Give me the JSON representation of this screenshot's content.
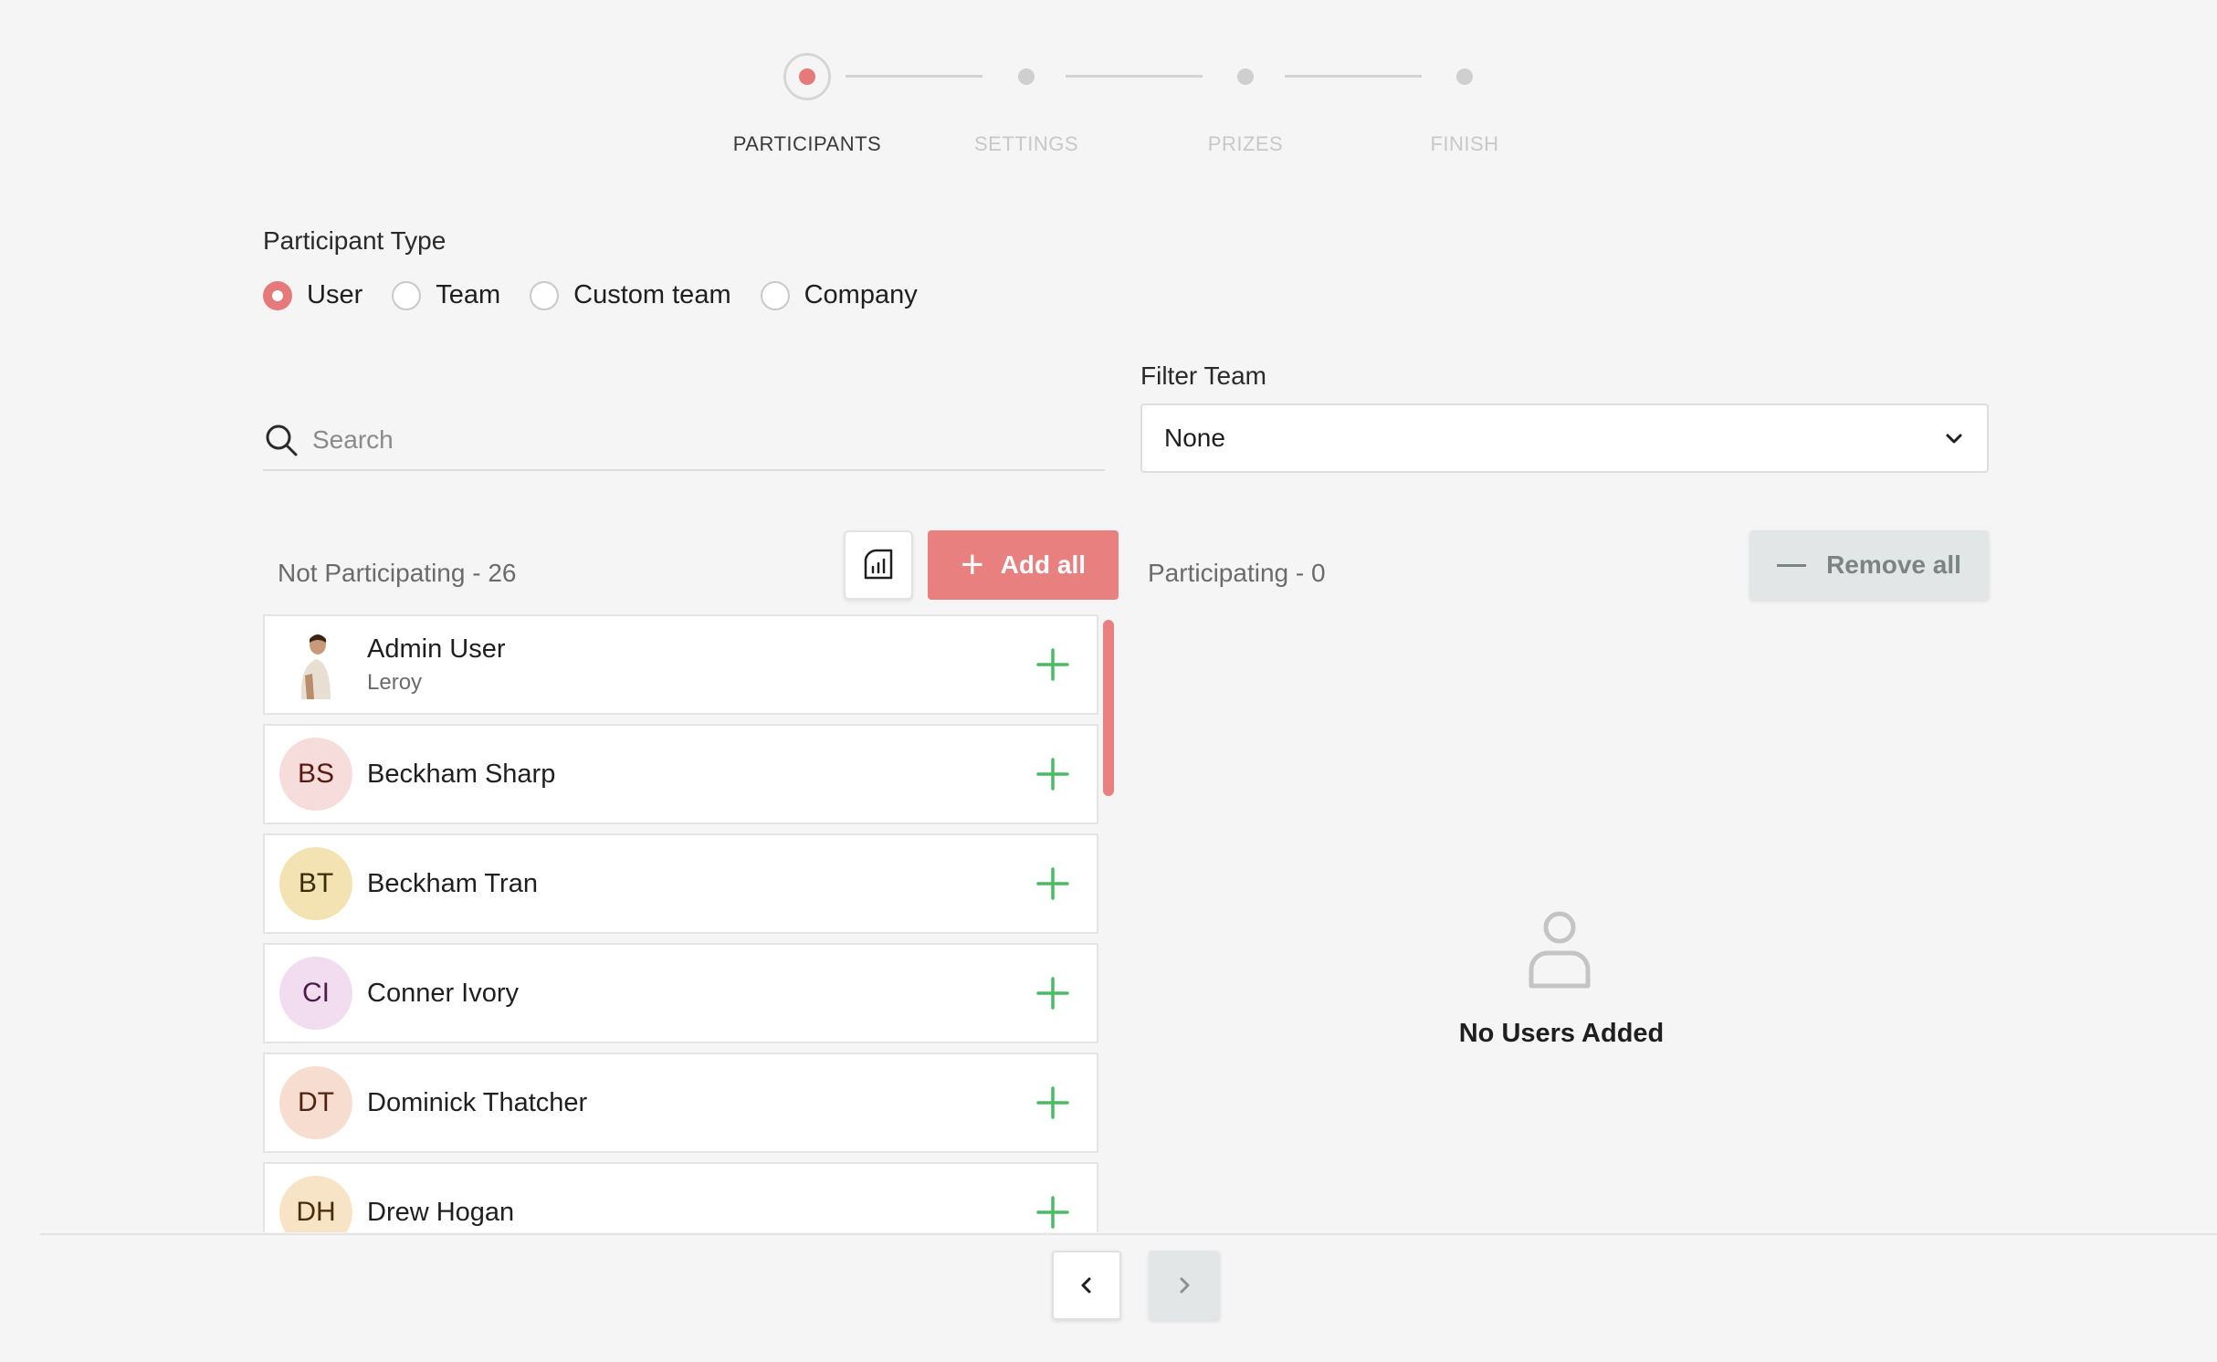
{
  "stepper": {
    "steps": [
      {
        "label": "PARTICIPANTS",
        "active": true
      },
      {
        "label": "SETTINGS",
        "active": false
      },
      {
        "label": "PRIZES",
        "active": false
      },
      {
        "label": "FINISH",
        "active": false
      }
    ]
  },
  "participant_type": {
    "title": "Participant Type",
    "options": [
      {
        "label": "User",
        "checked": true
      },
      {
        "label": "Team",
        "checked": false
      },
      {
        "label": "Custom team",
        "checked": false
      },
      {
        "label": "Company",
        "checked": false
      }
    ]
  },
  "search": {
    "placeholder": "Search",
    "value": ""
  },
  "filter_team": {
    "label": "Filter Team",
    "selected": "None"
  },
  "not_participating": {
    "title": "Not Participating - 26",
    "add_all_label": "Add all",
    "users": [
      {
        "name": "Admin User",
        "subtitle": "Leroy",
        "initials": "",
        "avatar": "photo",
        "bg": "#ffffff",
        "fg": "#1f1f1f"
      },
      {
        "name": "Beckham Sharp",
        "subtitle": "",
        "initials": "BS",
        "avatar": "initials",
        "bg": "#f6dcda",
        "fg": "#5a1a14"
      },
      {
        "name": "Beckham Tran",
        "subtitle": "",
        "initials": "BT",
        "avatar": "initials",
        "bg": "#f3e3b2",
        "fg": "#3b2c08"
      },
      {
        "name": "Conner Ivory",
        "subtitle": "",
        "initials": "CI",
        "avatar": "initials",
        "bg": "#f1dcf0",
        "fg": "#4b1d4a"
      },
      {
        "name": "Dominick Thatcher",
        "subtitle": "",
        "initials": "DT",
        "avatar": "initials",
        "bg": "#f6ddd0",
        "fg": "#4f2412"
      },
      {
        "name": "Drew Hogan",
        "subtitle": "",
        "initials": "DH",
        "avatar": "initials",
        "bg": "#f7e4c7",
        "fg": "#4a2e0a"
      }
    ]
  },
  "participating": {
    "title": "Participating - 0",
    "remove_all_label": "Remove all",
    "empty_text": "No Users Added"
  },
  "colors": {
    "accent": "#e98080",
    "add_icon": "#4cbb64",
    "muted_button": "#e3e6e6"
  },
  "icons": {
    "search": "search-icon",
    "report": "report-icon",
    "add": "plus-icon",
    "remove": "minus-icon",
    "dropdown": "chevron-down-icon",
    "empty": "user-outline-icon",
    "prev": "chevron-left-icon",
    "next": "chevron-right-icon"
  }
}
